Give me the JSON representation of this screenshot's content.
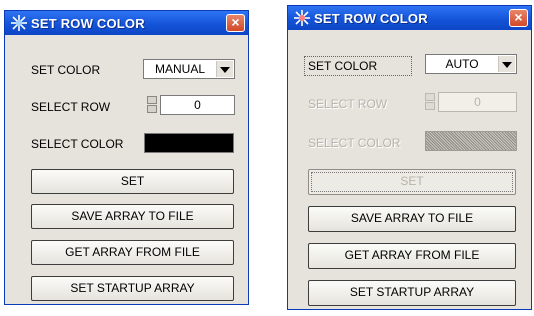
{
  "left": {
    "title": "SET ROW COLOR",
    "close_glyph": "×",
    "set_color_label": "SET COLOR",
    "set_color_value": "MANUAL",
    "select_row_label": "SELECT ROW",
    "select_row_value": "0",
    "select_color_label": "SELECT COLOR",
    "select_color_swatch": "#000000",
    "set_button": "SET",
    "save_button": "SAVE ARRAY TO FILE",
    "get_button": "GET ARRAY FROM FILE",
    "startup_button": "SET STARTUP ARRAY"
  },
  "right": {
    "title": "SET ROW COLOR",
    "close_glyph": "×",
    "set_color_label": "SET COLOR",
    "set_color_value": "AUTO",
    "select_row_label": "SELECT ROW",
    "select_row_value": "0",
    "select_color_label": "SELECT COLOR",
    "set_button": "SET",
    "save_button": "SAVE ARRAY TO FILE",
    "get_button": "GET ARRAY FROM FILE",
    "startup_button": "SET STARTUP ARRAY"
  },
  "icons": {
    "title_icon": "sparkle-icon",
    "close_icon": "close-icon",
    "spinner_icon": "spinner-icon",
    "dropdown_icon": "chevron-down-icon"
  },
  "colors": {
    "titlebar": "#1454d8",
    "close": "#d1492a",
    "dialog_bg": "#e5e3dc"
  }
}
